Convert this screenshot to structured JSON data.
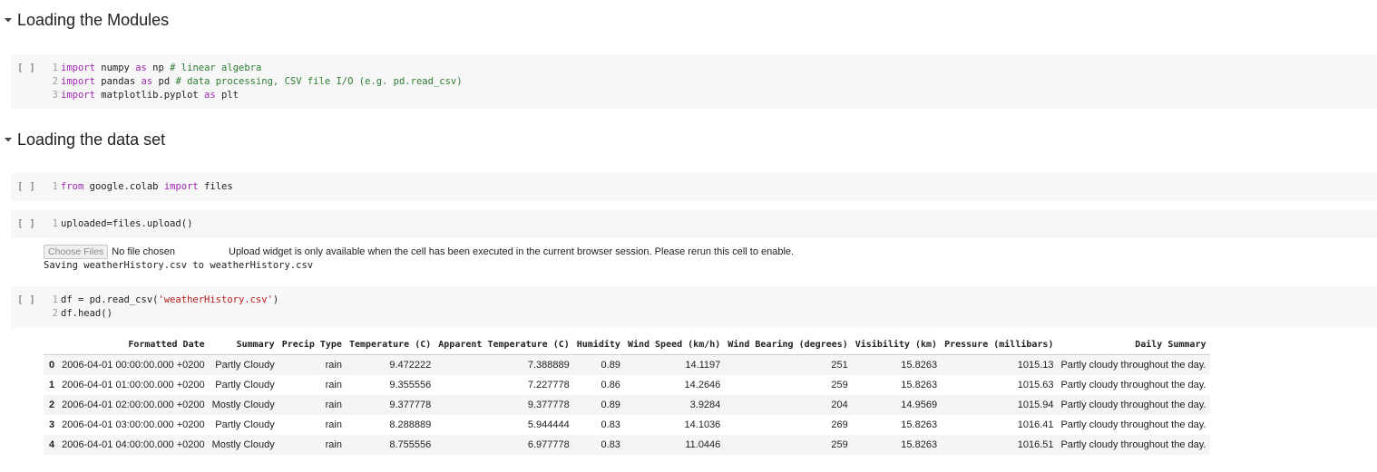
{
  "sections": [
    {
      "title": "Loading the Modules"
    },
    {
      "title": "Loading the data set"
    }
  ],
  "run_button": "[ ]",
  "cell1": {
    "lines": [
      {
        "n": "1",
        "tokens": [
          [
            "kw",
            "import"
          ],
          [
            "plain",
            " numpy "
          ],
          [
            "kw",
            "as"
          ],
          [
            "plain",
            " np "
          ],
          [
            "cm",
            "# linear algebra"
          ]
        ]
      },
      {
        "n": "2",
        "tokens": [
          [
            "kw",
            "import"
          ],
          [
            "plain",
            " pandas "
          ],
          [
            "kw",
            "as"
          ],
          [
            "plain",
            " pd "
          ],
          [
            "cm",
            "# data processing, CSV file I/O (e.g. pd.read_csv)"
          ]
        ]
      },
      {
        "n": "3",
        "tokens": [
          [
            "kw",
            "import"
          ],
          [
            "plain",
            " matplotlib.pyplot "
          ],
          [
            "kw",
            "as"
          ],
          [
            "plain",
            " plt"
          ]
        ]
      }
    ]
  },
  "cell2": {
    "lines": [
      {
        "n": "1",
        "tokens": [
          [
            "kw",
            "from"
          ],
          [
            "plain",
            " google.colab "
          ],
          [
            "kw",
            "import"
          ],
          [
            "plain",
            " files"
          ]
        ]
      }
    ]
  },
  "cell3": {
    "lines": [
      {
        "n": "1",
        "tokens": [
          [
            "plain",
            "uploaded=files.upload()"
          ]
        ]
      }
    ]
  },
  "upload_output": {
    "choose_files": "Choose Files",
    "no_file": "No file chosen",
    "message": "Upload widget is only available when the cell has been executed in the current browser session. Please rerun this cell to enable.",
    "saving": "Saving weatherHistory.csv to weatherHistory.csv"
  },
  "cell4": {
    "lines": [
      {
        "n": "1",
        "tokens": [
          [
            "plain",
            "df = pd.read_csv("
          ],
          [
            "str",
            "'weatherHistory.csv'"
          ],
          [
            "plain",
            ")"
          ]
        ]
      },
      {
        "n": "2",
        "tokens": [
          [
            "plain",
            "df.head()"
          ]
        ]
      }
    ]
  },
  "dataframe": {
    "columns": [
      "",
      "Formatted Date",
      "Summary",
      "Precip Type",
      "Temperature (C)",
      "Apparent Temperature (C)",
      "Humidity",
      "Wind Speed (km/h)",
      "Wind Bearing (degrees)",
      "Visibility (km)",
      "Pressure (millibars)",
      "Daily Summary"
    ],
    "rows": [
      [
        "0",
        "2006-04-01 00:00:00.000 +0200",
        "Partly Cloudy",
        "rain",
        "9.472222",
        "7.388889",
        "0.89",
        "14.1197",
        "251",
        "15.8263",
        "1015.13",
        "Partly cloudy throughout the day."
      ],
      [
        "1",
        "2006-04-01 01:00:00.000 +0200",
        "Partly Cloudy",
        "rain",
        "9.355556",
        "7.227778",
        "0.86",
        "14.2646",
        "259",
        "15.8263",
        "1015.63",
        "Partly cloudy throughout the day."
      ],
      [
        "2",
        "2006-04-01 02:00:00.000 +0200",
        "Mostly Cloudy",
        "rain",
        "9.377778",
        "9.377778",
        "0.89",
        "3.9284",
        "204",
        "14.9569",
        "1015.94",
        "Partly cloudy throughout the day."
      ],
      [
        "3",
        "2006-04-01 03:00:00.000 +0200",
        "Partly Cloudy",
        "rain",
        "8.288889",
        "5.944444",
        "0.83",
        "14.1036",
        "269",
        "15.8263",
        "1016.41",
        "Partly cloudy throughout the day."
      ],
      [
        "4",
        "2006-04-01 04:00:00.000 +0200",
        "Mostly Cloudy",
        "rain",
        "8.755556",
        "6.977778",
        "0.83",
        "11.0446",
        "259",
        "15.8263",
        "1016.51",
        "Partly cloudy throughout the day."
      ]
    ]
  }
}
